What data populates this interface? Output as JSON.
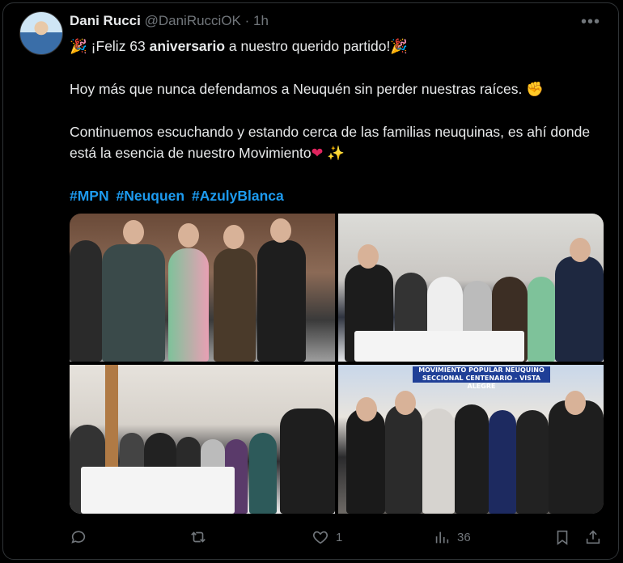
{
  "tweet": {
    "author_name": "Dani Rucci",
    "handle": "@DaniRucciOK",
    "separator": "·",
    "time": "1h",
    "more": "•••",
    "line1_pre": "¡Feliz 63 ",
    "line1_bold": "aniversario",
    "line1_post": " a nuestro querido partido!",
    "line2": "Hoy más que nunca defendamos a Neuquén sin perder nuestras raíces.",
    "line3": "Continuemos escuchando y estando cerca de las familias neuquinas, es ahí donde está la esencia de nuestro Movimiento",
    "hashtags": [
      "#MPN",
      "#Neuquen",
      "#AzulyBlanca"
    ],
    "emoji_party": "🎉",
    "emoji_fist": "✊",
    "emoji_heart": "❤",
    "emoji_sparkles": "✨"
  },
  "media": {
    "sign_text_line1": "MOVIMIENTO POPULAR NEUQUINO",
    "sign_text_line2": "SECCIONAL CENTENARIO - VISTA ALEGRE"
  },
  "actions": {
    "reply_count": "",
    "retweet_count": "",
    "like_count": "1",
    "views_count": "36"
  },
  "colors": {
    "background": "#000000",
    "text": "#e7e9ea",
    "muted": "#71767b",
    "link": "#1d9bf0"
  }
}
